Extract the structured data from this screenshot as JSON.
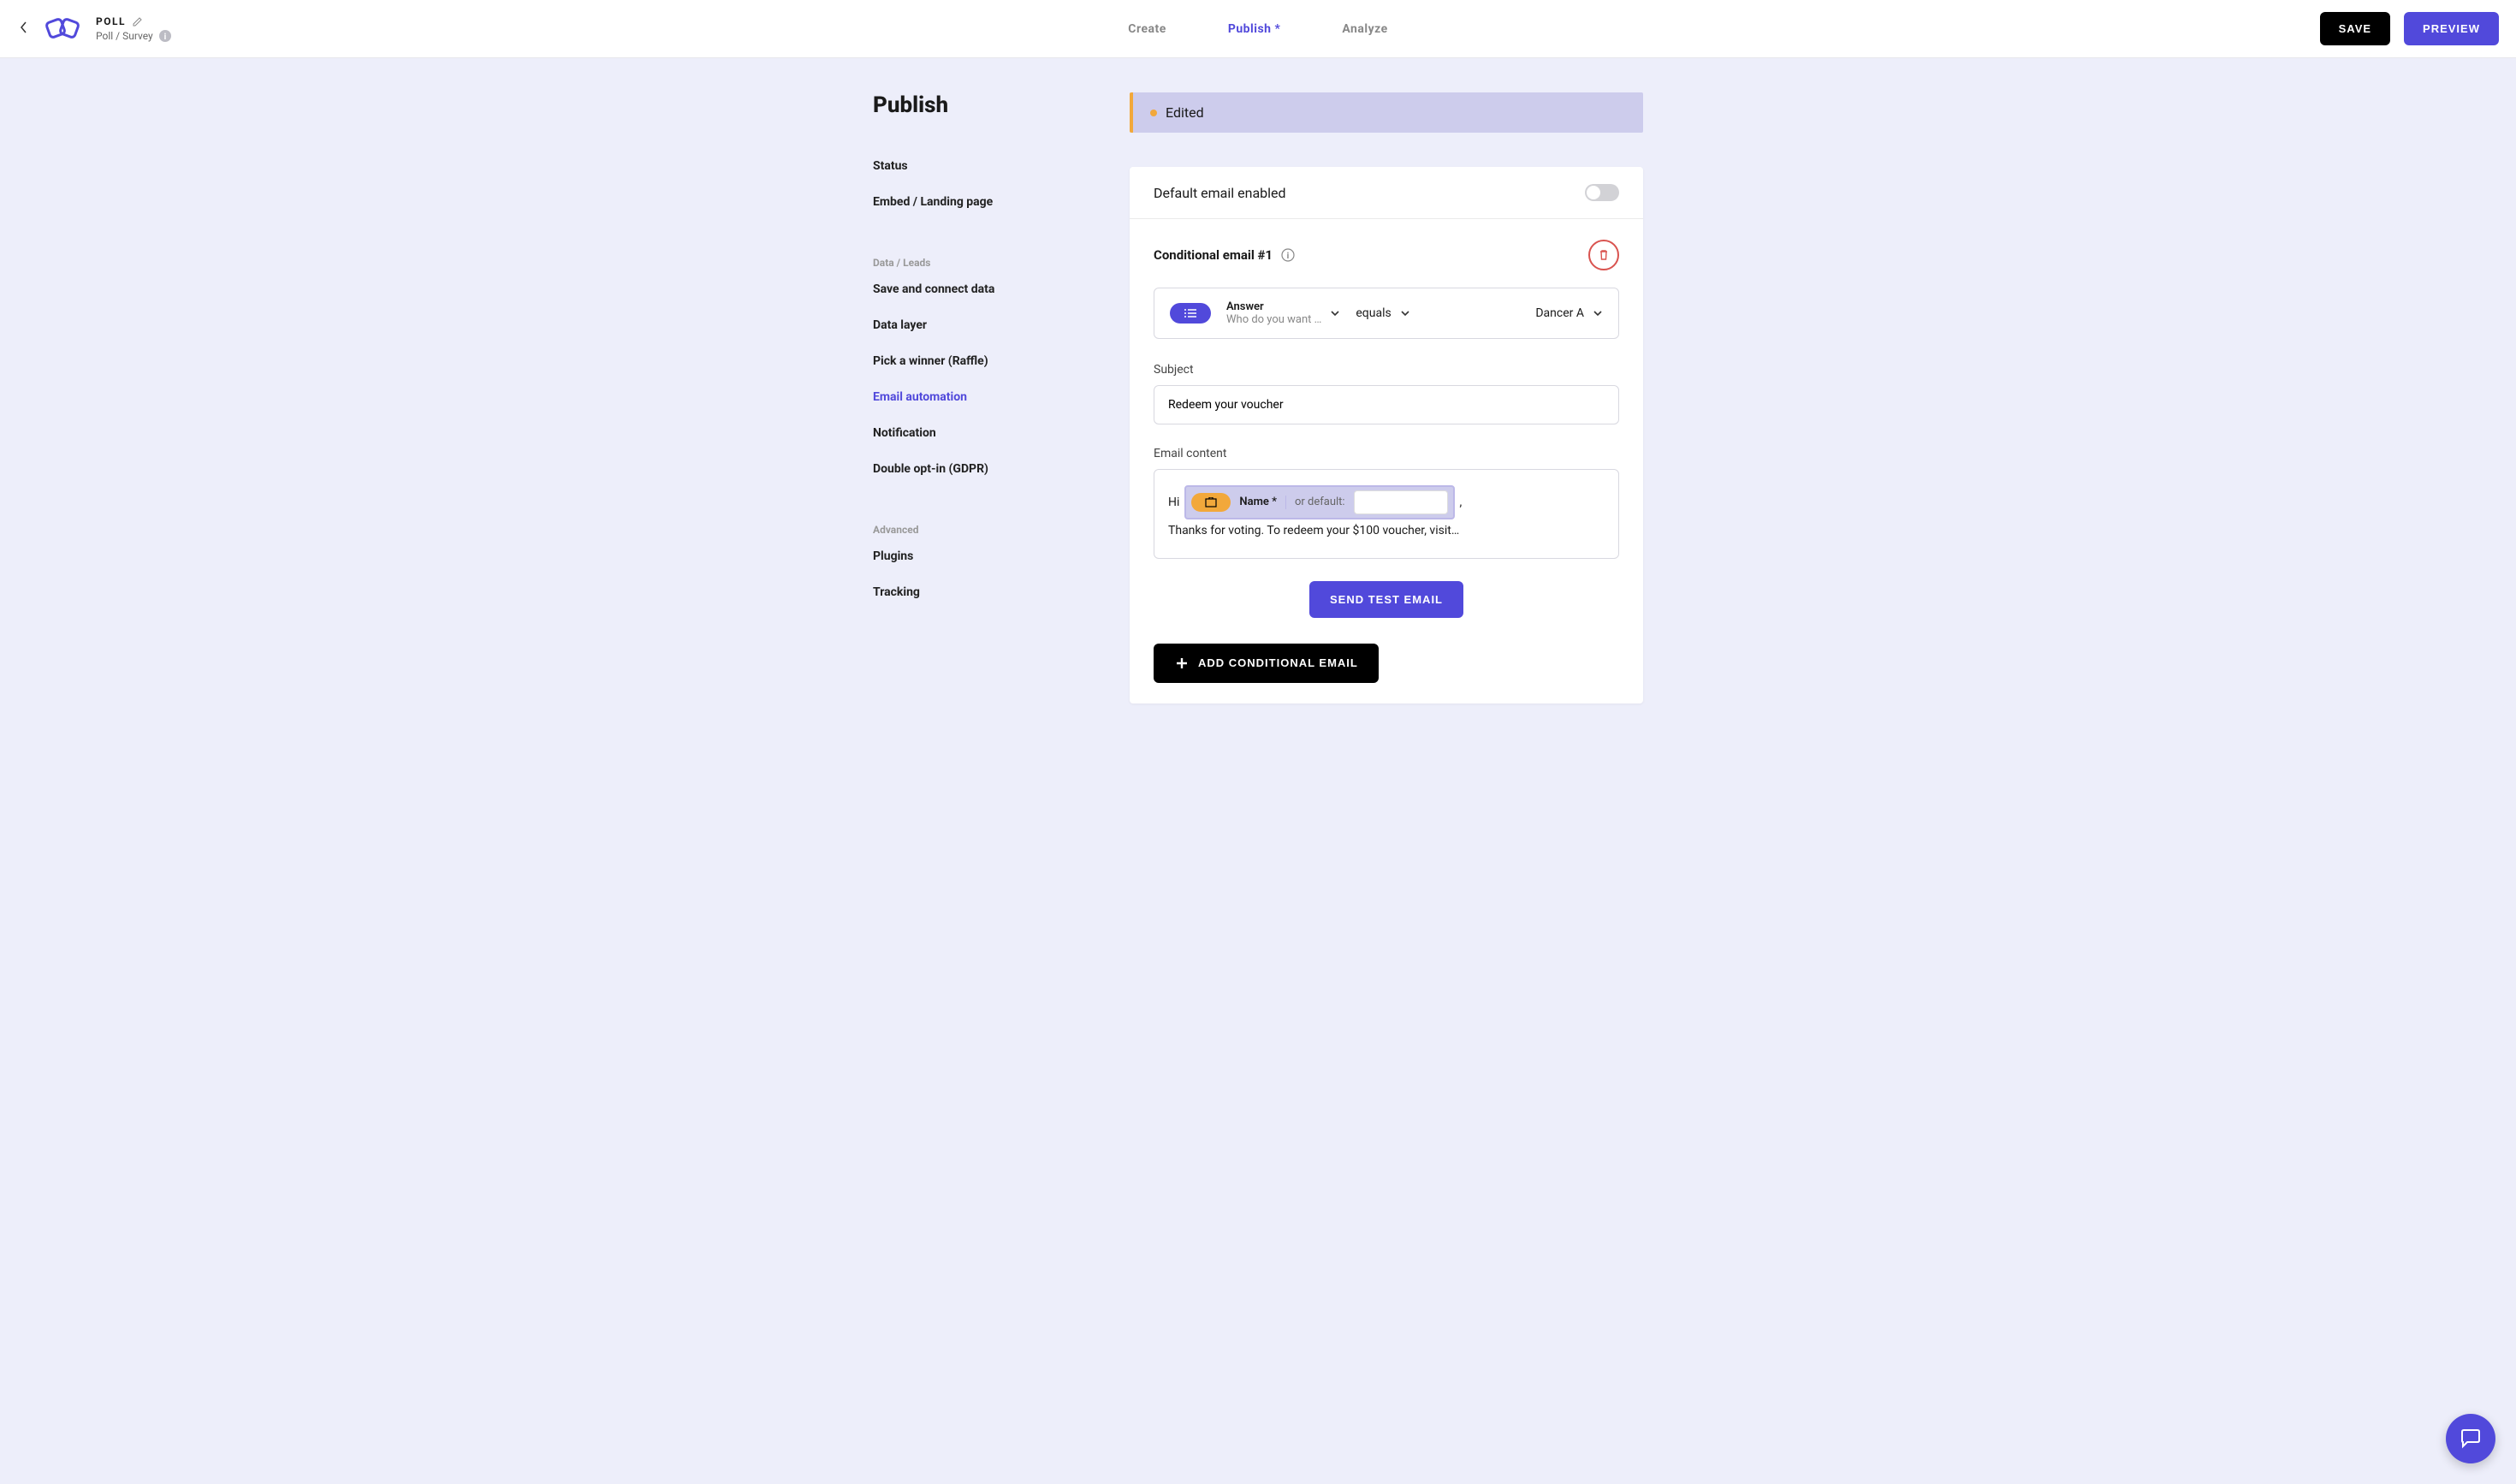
{
  "header": {
    "title": "POLL",
    "subtitle": "Poll / Survey",
    "tabs": {
      "create": "Create",
      "publish": "Publish *",
      "analyze": "Analyze"
    },
    "save_label": "SAVE",
    "preview_label": "PREVIEW"
  },
  "sidebar": {
    "heading": "Publish",
    "items": {
      "status": "Status",
      "embed": "Embed / Landing page",
      "data_label": "Data / Leads",
      "save_connect": "Save and connect data",
      "data_layer": "Data layer",
      "raffle": "Pick a winner (Raffle)",
      "email_automation": "Email automation",
      "notification": "Notification",
      "double_opt": "Double opt-in (GDPR)",
      "advanced_label": "Advanced",
      "plugins": "Plugins",
      "tracking": "Tracking"
    }
  },
  "status_banner": "Edited",
  "default_email_label": "Default email enabled",
  "conditional": {
    "title": "Conditional email #1",
    "answer_label": "Answer",
    "answer_sub": "Who do you want …",
    "operator": "equals",
    "value": "Dancer A"
  },
  "subject": {
    "label": "Subject",
    "value": "Redeem your voucher"
  },
  "email_content": {
    "label": "Email content",
    "prefix": "Hi",
    "merge_name": "Name *",
    "merge_default_label": "or default:",
    "merge_default_value": "",
    "suffix_comma": ",",
    "body_line2": "Thanks for voting. To redeem your $100 voucher, visit…"
  },
  "buttons": {
    "send_test": "SEND TEST EMAIL",
    "add_conditional": "ADD CONDITIONAL EMAIL"
  }
}
